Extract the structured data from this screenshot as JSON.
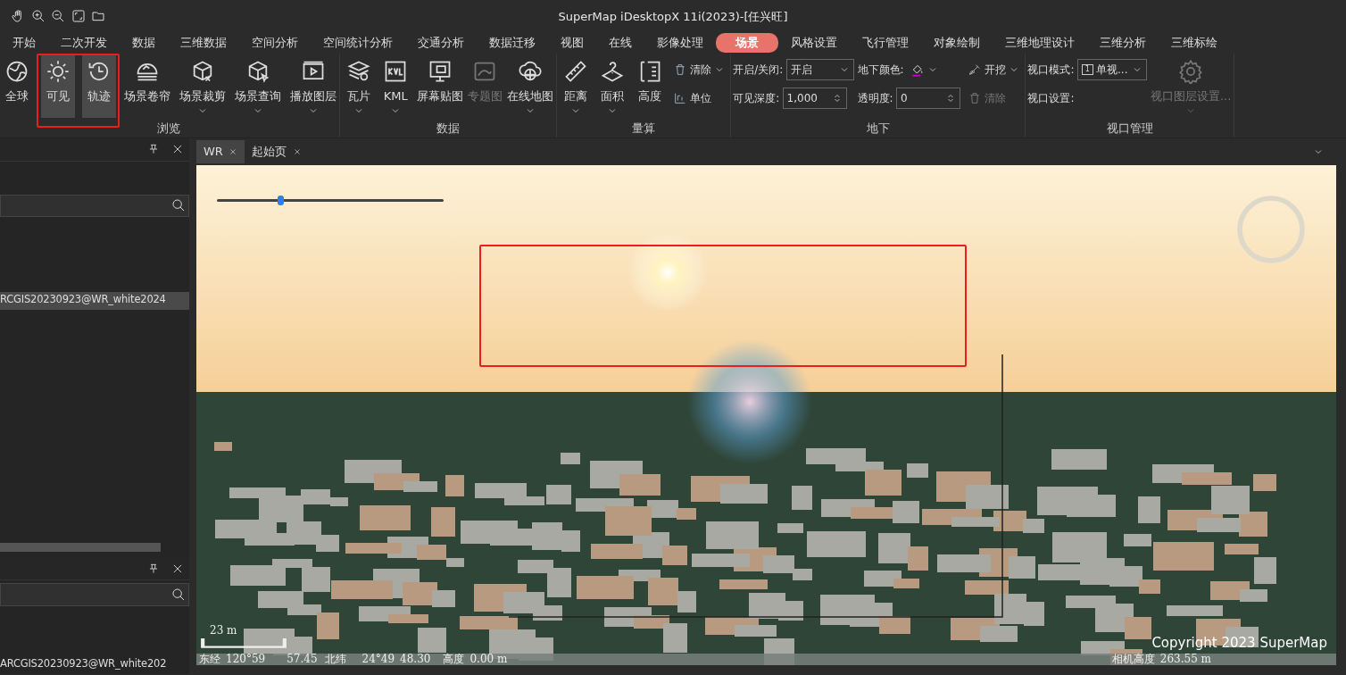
{
  "window": {
    "title": "SuperMap iDesktopX 11i(2023)-[任兴旺]"
  },
  "ribbon_tabs": [
    {
      "label": "开始",
      "selected": false
    },
    {
      "label": "二次开发",
      "selected": false
    },
    {
      "label": "数据",
      "selected": false
    },
    {
      "label": "三维数据",
      "selected": false
    },
    {
      "label": "空间分析",
      "selected": false
    },
    {
      "label": "空间统计分析",
      "selected": false
    },
    {
      "label": "交通分析",
      "selected": false
    },
    {
      "label": "数据迁移",
      "selected": false
    },
    {
      "label": "视图",
      "selected": false
    },
    {
      "label": "在线",
      "selected": false
    },
    {
      "label": "影像处理",
      "selected": false
    },
    {
      "label": "场景",
      "selected": true
    },
    {
      "label": "风格设置",
      "selected": false
    },
    {
      "label": "飞行管理",
      "selected": false
    },
    {
      "label": "对象绘制",
      "selected": false
    },
    {
      "label": "三维地理设计",
      "selected": false
    },
    {
      "label": "三维分析",
      "selected": false
    },
    {
      "label": "三维标绘",
      "selected": false
    }
  ],
  "ribbon_groups": [
    {
      "label": "浏览",
      "items": [
        {
          "kind": "large",
          "label": "全球",
          "pressed": false,
          "dropdown": false,
          "disabled": false
        },
        {
          "kind": "large",
          "label": "可见",
          "pressed": true,
          "dropdown": false,
          "disabled": false
        },
        {
          "kind": "large",
          "label": "轨迹",
          "pressed": true,
          "dropdown": false,
          "disabled": false
        },
        {
          "kind": "large",
          "label": "场景卷帘",
          "pressed": false,
          "dropdown": false,
          "disabled": false
        },
        {
          "kind": "large",
          "label": "场景裁剪",
          "pressed": false,
          "dropdown": true,
          "disabled": false
        },
        {
          "kind": "large",
          "label": "场景查询",
          "pressed": false,
          "dropdown": true,
          "disabled": false
        },
        {
          "kind": "large",
          "label": "播放图层",
          "pressed": false,
          "dropdown": true,
          "disabled": false
        }
      ]
    },
    {
      "label": "数据",
      "items": [
        {
          "kind": "large",
          "label": "瓦片",
          "pressed": false,
          "dropdown": true,
          "disabled": false
        },
        {
          "kind": "large",
          "label": "KML",
          "pressed": false,
          "dropdown": true,
          "disabled": false
        },
        {
          "kind": "large",
          "label": "屏幕贴图",
          "pressed": false,
          "dropdown": false,
          "disabled": false
        },
        {
          "kind": "large",
          "label": "专题图",
          "pressed": false,
          "dropdown": false,
          "disabled": true
        },
        {
          "kind": "large",
          "label": "在线地图",
          "pressed": false,
          "dropdown": true,
          "disabled": false
        }
      ]
    },
    {
      "label": "量算",
      "items": [
        {
          "kind": "large",
          "label": "距离",
          "pressed": false,
          "dropdown": true,
          "disabled": false
        },
        {
          "kind": "large",
          "label": "面积",
          "pressed": false,
          "dropdown": true,
          "disabled": false
        },
        {
          "kind": "large",
          "label": "高度",
          "pressed": false,
          "dropdown": false,
          "disabled": false
        },
        {
          "kind": "tool",
          "label": "清除",
          "dropdown": true,
          "disabled": false
        },
        {
          "kind": "tool",
          "label": "单位",
          "dropdown": false,
          "disabled": false
        }
      ]
    },
    {
      "label": "地下",
      "items": [
        {
          "kind": "select",
          "label": "开启/关闭:",
          "value": "开启"
        },
        {
          "kind": "color",
          "label": "地下颜色:"
        },
        {
          "kind": "tool",
          "label": "开挖",
          "dropdown": true,
          "disabled": false
        },
        {
          "kind": "spin",
          "label": "可见深度:",
          "value": "1,000"
        },
        {
          "kind": "spin",
          "label": "透明度:",
          "value": "0"
        },
        {
          "kind": "tool",
          "label": "清除",
          "dropdown": false,
          "disabled": true
        }
      ]
    },
    {
      "label": "视口管理",
      "items": [
        {
          "kind": "select",
          "label": "视口模式:",
          "value": "单视...",
          "badge": "1"
        },
        {
          "kind": "text",
          "label": "视口设置:"
        },
        {
          "kind": "large",
          "label": "视口图层设置...",
          "pressed": false,
          "dropdown": true,
          "disabled": true
        }
      ]
    }
  ],
  "left_panels": [
    {
      "items": [
        {
          "label": "RCGIS20230923@WR_white2024",
          "selected": true
        }
      ]
    },
    {
      "items": [
        {
          "label": "ARCGIS20230923@WR_white202",
          "selected": false
        }
      ]
    }
  ],
  "document_tabs": [
    {
      "label": "WR",
      "selected": true
    },
    {
      "label": "起始页",
      "selected": false
    }
  ],
  "scene": {
    "slider": {
      "level": 0.28
    },
    "scale": "23 m",
    "copyright": "Copyright 2023 SuperMap",
    "status": [
      "东经",
      "120°59",
      "57.45",
      "北纬",
      "24°49",
      "48.30",
      "高度",
      "0.00 m"
    ],
    "camera": [
      "相机高度",
      "263.55 m"
    ]
  }
}
